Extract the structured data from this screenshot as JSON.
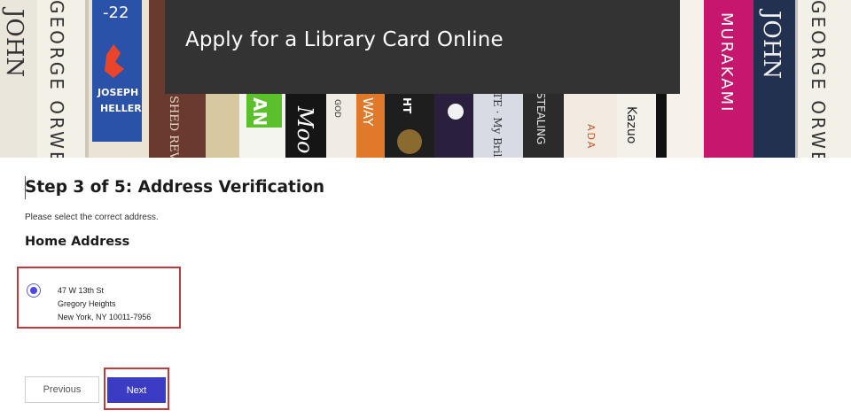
{
  "banner": {
    "title": "Apply for a Library Card Online",
    "spine_texts": {
      "orwell_left": "GEORGE ORWELL",
      "john_left": "JOHN",
      "heller_num": "-22",
      "heller_name_1": "JOSEPH",
      "heller_name_2": "HELLER",
      "murakami": "MURAKAMI",
      "john_right": "JOHN",
      "orwell_right": "GEORGE ORWELL",
      "kazuo": "Kazuo",
      "adam": "ADA",
      "stealing": "STEALING",
      "brilli": "TE · My Brilli",
      "an": "AN",
      "moo": "Moo",
      "way": "WAY",
      "ht": "HT",
      "god": "GOD",
      "shed": "SHED REVE"
    }
  },
  "step": {
    "title": "Step 3 of 5: Address Verification",
    "instructions": "Please select the correct address."
  },
  "home_address": {
    "heading": "Home Address",
    "selected": true,
    "lines": [
      "47 W 13th St",
      "Gregory Heights",
      "New York, NY 10011-7956"
    ]
  },
  "buttons": {
    "previous": "Previous",
    "next": "Next"
  },
  "colors": {
    "title_box": "#333333",
    "highlight_border": "#c0393b",
    "primary_button": "#3b3bc4",
    "radio_selected": "#4f46e5"
  }
}
